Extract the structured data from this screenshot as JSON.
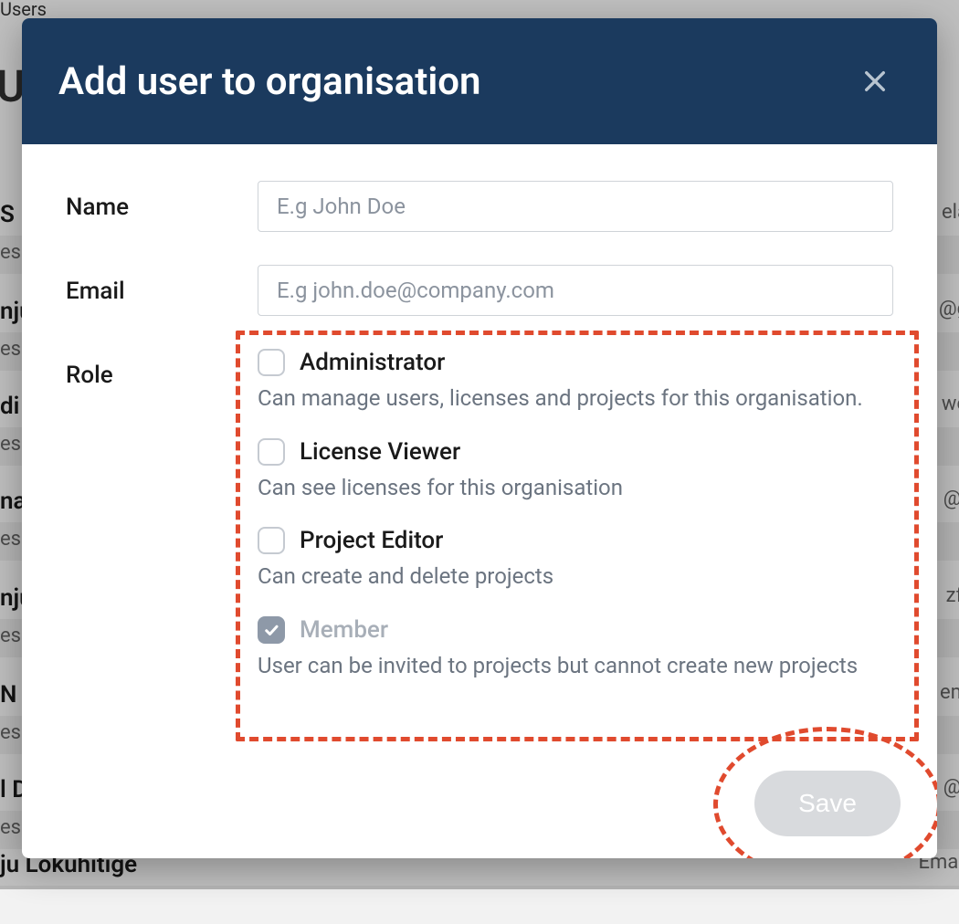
{
  "background": {
    "breadcrumb": "Users",
    "page_title": "Us",
    "rows": [
      {
        "name_frag": "S",
        "sub": "es",
        "email_frag": "ela"
      },
      {
        "name_frag": "nju",
        "sub": "es",
        "email_frag": "@g"
      },
      {
        "name_frag": "di",
        "sub": "es",
        "email_frag": "wo"
      },
      {
        "name_frag": "na",
        "sub": "es",
        "email_frag": "@r"
      },
      {
        "name_frag": "nju",
        "sub": "es",
        "email_frag": "zf."
      },
      {
        "name_frag": " N",
        "sub": "es",
        "email_frag": "em"
      },
      {
        "name_frag": "l D",
        "sub": "es",
        "email_frag": "@r"
      },
      {
        "name_frag": "ju Lokuhitige",
        "sub": "",
        "email_frag": "Email"
      }
    ]
  },
  "modal": {
    "title": "Add user to organisation",
    "labels": {
      "name": "Name",
      "email": "Email",
      "role": "Role"
    },
    "placeholders": {
      "name": "E.g John Doe",
      "email": "E.g john.doe@company.com"
    },
    "roles": [
      {
        "title": "Administrator",
        "desc": "Can manage users, licenses and projects for this organisation.",
        "checked": false,
        "disabled": false
      },
      {
        "title": "License Viewer",
        "desc": "Can see licenses for this organisation",
        "checked": false,
        "disabled": false
      },
      {
        "title": "Project Editor",
        "desc": "Can create and delete projects",
        "checked": false,
        "disabled": false
      },
      {
        "title": "Member",
        "desc": "User can be invited to projects but cannot create new projects",
        "checked": true,
        "disabled": true
      }
    ],
    "save_label": "Save"
  }
}
